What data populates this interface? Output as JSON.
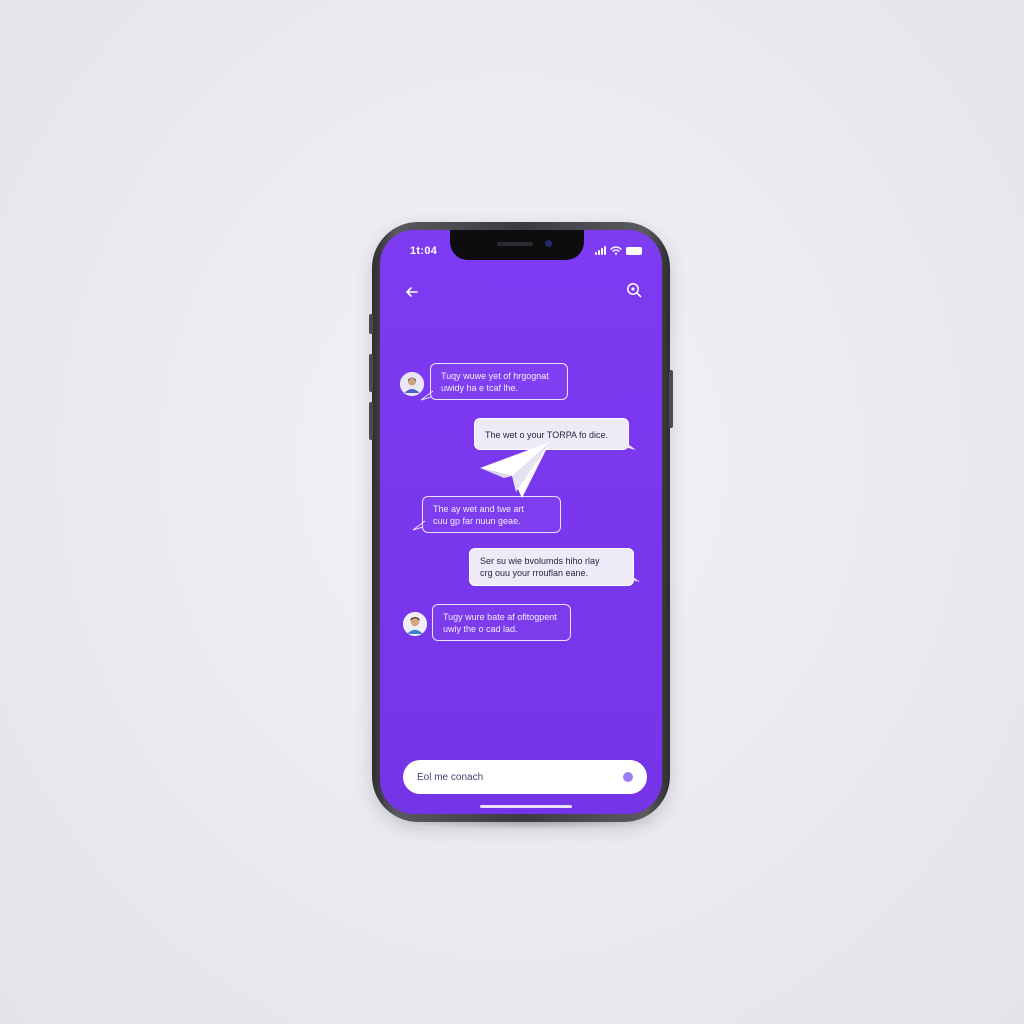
{
  "status_bar": {
    "time": "1t:04",
    "signal_icon": "signal-icon",
    "wifi_icon": "wifi-icon",
    "battery_icon": "battery-icon"
  },
  "header": {
    "back_icon": "arrow-left-icon",
    "search_icon": "search-icon"
  },
  "messages": [
    {
      "side": "left",
      "style": "outline",
      "avatar": true,
      "line1": "Tuqy wuwe yet of hrgognat",
      "line2": "uwidy ha e tcaf lhe."
    },
    {
      "side": "right",
      "style": "filled",
      "avatar": false,
      "line1": "The wet o your TORPA fo dice.",
      "line2": ""
    },
    {
      "side": "left",
      "style": "outline",
      "avatar": false,
      "line1": "The ay wet and twe art",
      "line2": "cuu gp far nuun geae."
    },
    {
      "side": "right",
      "style": "filled",
      "avatar": false,
      "line1": "Ser su wie bvolumds hiho rlay",
      "line2": "crg ouu your rrouflan eane."
    },
    {
      "side": "left",
      "style": "outline",
      "avatar": true,
      "line1": "Tugy wure bate af ofitogpent",
      "line2": "uwiy the o cad lad."
    }
  ],
  "center_icon": "paper-plane-icon",
  "composer": {
    "placeholder": "Eol me conach",
    "send_icon": "send-dot-icon"
  },
  "colors": {
    "screen": "#7c3aed",
    "bubble_fill": "#efeaf7",
    "background": "#ececf0"
  }
}
